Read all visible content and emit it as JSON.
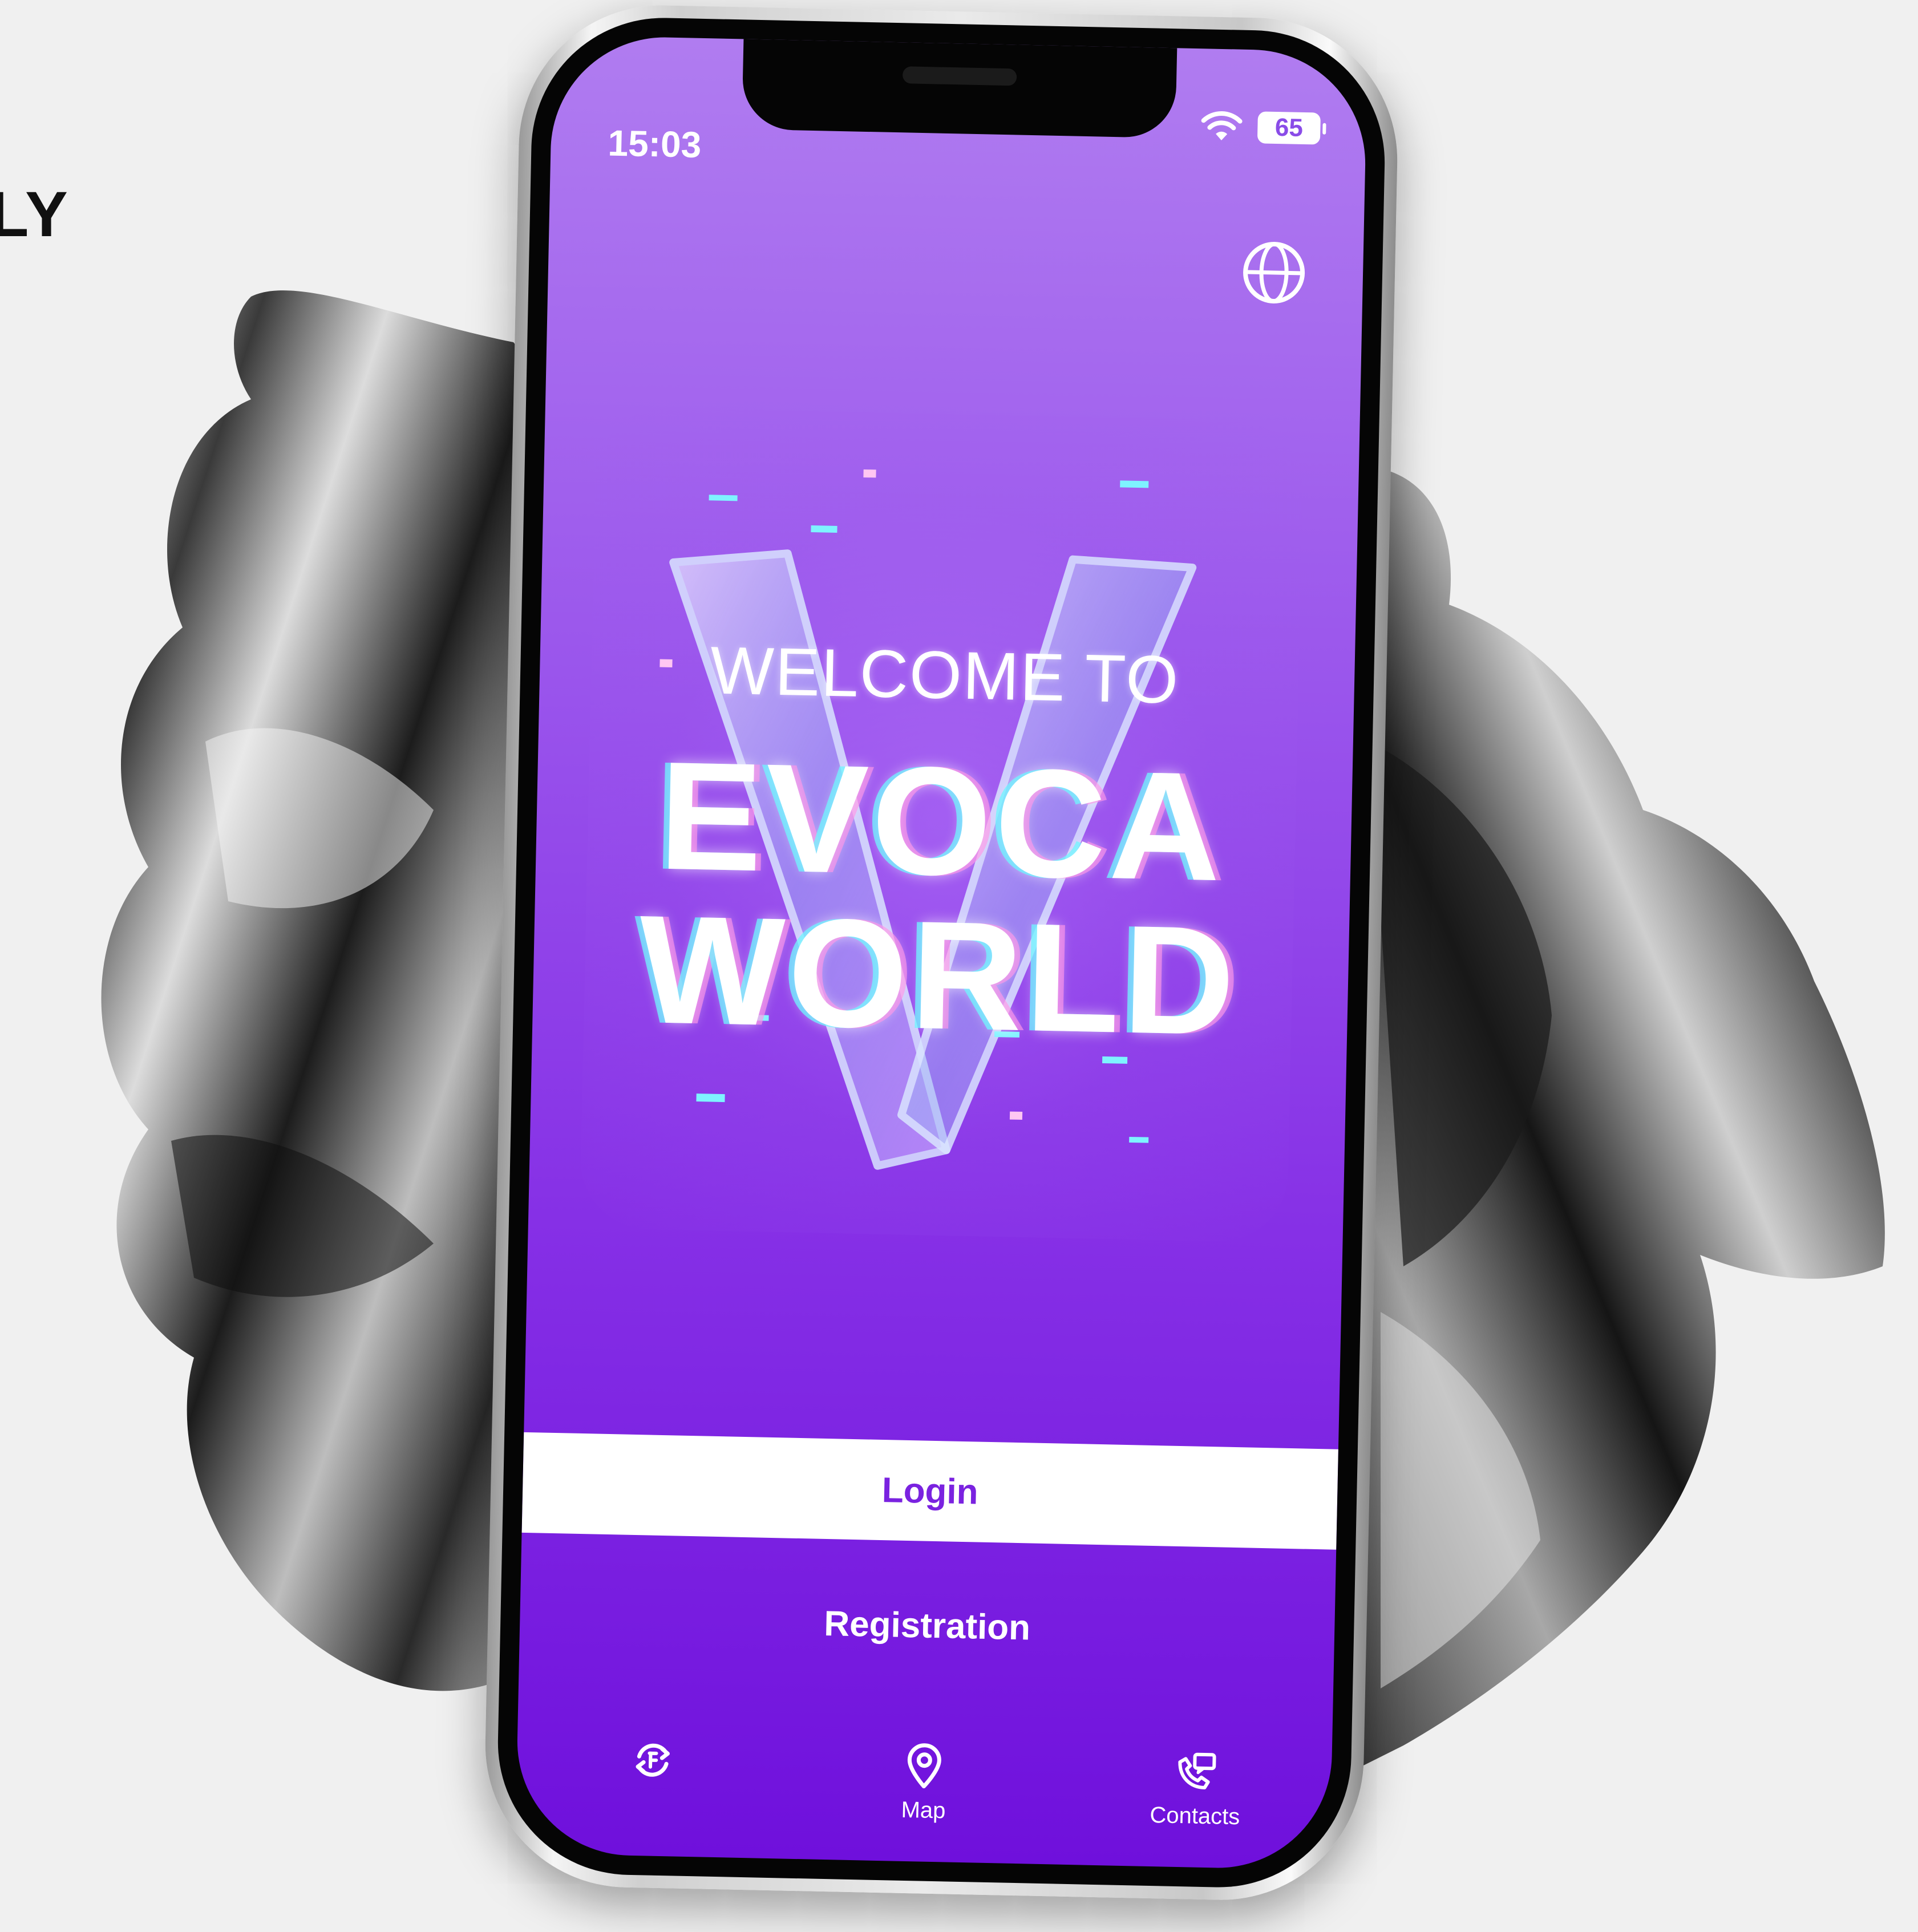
{
  "side_heading": "LY",
  "status_bar": {
    "time": "15:03",
    "battery": "65"
  },
  "header": {
    "language_icon": "globe-icon"
  },
  "logo": {
    "welcome": "WELCOME TO",
    "brand_line1": "EVOCA",
    "brand_line2": "WORLD"
  },
  "actions": {
    "login_label": "Login",
    "registration_label": "Registration"
  },
  "bottom_nav": {
    "items": [
      {
        "icon": "exchange-icon",
        "label": ""
      },
      {
        "icon": "map-pin-icon",
        "label": "Map"
      },
      {
        "icon": "contacts-phone-icon",
        "label": "Contacts"
      }
    ]
  },
  "colors": {
    "accent": "#7a22e0",
    "screen_top": "#b07cf0",
    "screen_bottom": "#6f10dc",
    "background": "#f0f0f0"
  }
}
